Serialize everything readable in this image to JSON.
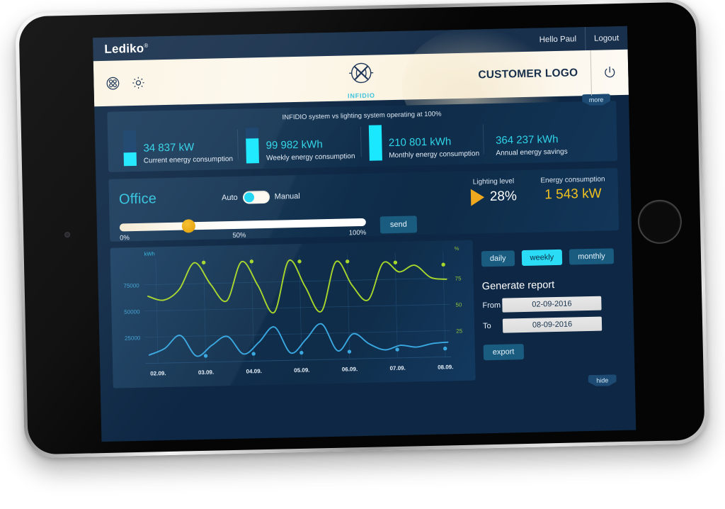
{
  "titlebar": {
    "brand": "Lediko",
    "brand_mark": "®",
    "hello": "Hello Paul",
    "logout": "Logout"
  },
  "header": {
    "infidio_name": "INFIDIO",
    "customer_logo": "CUSTOMER LOGO",
    "icons": [
      "sensors-icon",
      "gear-icon",
      "power-icon"
    ]
  },
  "stats": {
    "caption": "INFIDIO system vs lighting system operating at 100%",
    "more_label": "more",
    "items": [
      {
        "value": "34 837 kW",
        "label": "Current energy consumption",
        "bar_pct": 38,
        "has_bar": true
      },
      {
        "value": "99 982 kWh",
        "label": "Weekly energy consumption",
        "bar_pct": 70,
        "has_bar": true
      },
      {
        "value": "210 801 kWh",
        "label": "Monthly energy consumption",
        "bar_pct": 100,
        "has_bar": true
      },
      {
        "value": "364 237 kWh",
        "label": "Annual energy savings",
        "bar_pct": 0,
        "has_bar": false
      }
    ]
  },
  "control": {
    "zone": "Office",
    "mode_auto": "Auto",
    "mode_manual": "Manual",
    "mode_selected": "Auto",
    "slider_value_pct": 28,
    "slider_ticks": [
      "0%",
      "50%",
      "100%"
    ],
    "send_label": "send",
    "lighting_level_label": "Lighting level",
    "lighting_level_value": "28%",
    "energy_consumption_label": "Energy consumption",
    "energy_consumption_value": "1 543 kW"
  },
  "report": {
    "range_buttons": [
      {
        "label": "daily",
        "active": false
      },
      {
        "label": "weekly",
        "active": true
      },
      {
        "label": "monthly",
        "active": false
      }
    ],
    "title": "Generate report",
    "from_label": "From",
    "from_value": "02-09-2016",
    "to_label": "To",
    "to_value": "08-09-2016",
    "export_label": "export",
    "hide_label": "hide"
  },
  "colors": {
    "accent_cyan": "#2adcf5",
    "line_green": "#a8d72c",
    "line_blue": "#3aa8e0",
    "amber": "#f0c020",
    "panel_blue": "#12395e"
  },
  "chart_data": {
    "type": "line",
    "title": "",
    "xlabel": "",
    "ylabel": "kWh",
    "y2label": "%",
    "grid": true,
    "legend": "none",
    "categories": [
      "02.09.",
      "03.09.",
      "04.09.",
      "05.09.",
      "06.09.",
      "07.09.",
      "08.09."
    ],
    "ylim": [
      0,
      100000
    ],
    "yticks": [
      25000,
      50000,
      75000
    ],
    "y2lim": [
      0,
      100
    ],
    "y2ticks": [
      25,
      50,
      75
    ],
    "series": [
      {
        "name": "lighting system at 100%",
        "color": "#a8d72c",
        "axis": "left",
        "unit": "kWh",
        "marker_points": [
          {
            "x": "03.09.",
            "y": 95000
          },
          {
            "x": "04.09.",
            "y": 95000
          },
          {
            "x": "05.09.",
            "y": 94000
          },
          {
            "x": "06.09.",
            "y": 93000
          },
          {
            "x": "07.09.",
            "y": 91000
          },
          {
            "x": "08.09.",
            "y": 88000
          }
        ],
        "values": [
          64000,
          60000,
          70000,
          95000,
          74000,
          58000,
          95000,
          72000,
          46000,
          95000,
          70000,
          46000,
          93000,
          70000,
          56000,
          91000,
          82000,
          88000,
          76000,
          74000
        ]
      },
      {
        "name": "INFIDIO system",
        "color": "#3aa8e0",
        "axis": "right",
        "unit": "%",
        "marker_points": [
          {
            "x": "03.09.",
            "y": 6
          },
          {
            "x": "04.09.",
            "y": 7
          },
          {
            "x": "05.09.",
            "y": 7
          },
          {
            "x": "06.09.",
            "y": 7
          },
          {
            "x": "07.09.",
            "y": 8
          },
          {
            "x": "08.09.",
            "y": 8
          }
        ],
        "values": [
          8,
          14,
          26,
          6,
          16,
          24,
          7,
          18,
          32,
          7,
          20,
          34,
          8,
          24,
          14,
          8,
          12,
          10,
          13,
          14
        ]
      }
    ]
  }
}
